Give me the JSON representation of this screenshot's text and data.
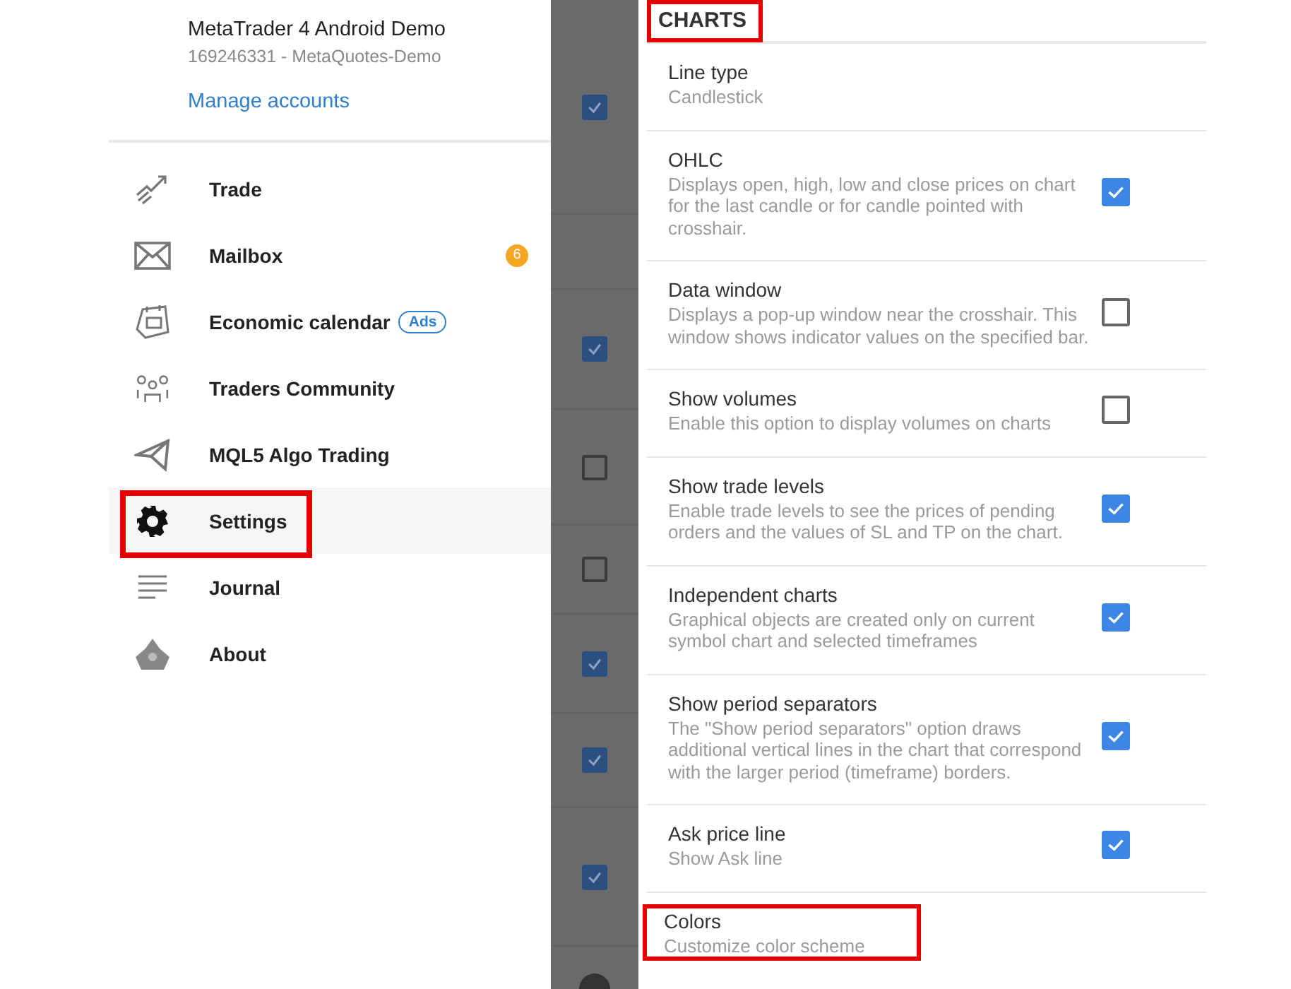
{
  "drawer": {
    "account_name": "MetaTrader 4 Android Demo",
    "account_id": "169246331 - MetaQuotes-Demo",
    "manage_link": "Manage accounts",
    "items": [
      {
        "kind": "trade",
        "label": "Trade",
        "selected": false,
        "outlined": false
      },
      {
        "kind": "mail",
        "label": "Mailbox",
        "badge": "6",
        "selected": false,
        "outlined": false
      },
      {
        "kind": "calendar",
        "label": "Economic calendar",
        "tag": "Ads",
        "selected": false,
        "outlined": false
      },
      {
        "kind": "community",
        "label": "Traders Community",
        "selected": false,
        "outlined": false
      },
      {
        "kind": "send",
        "label": "MQL5 Algo Trading",
        "selected": false,
        "outlined": false
      },
      {
        "kind": "settings",
        "label": "Settings",
        "selected": true,
        "outlined": true
      },
      {
        "kind": "journal",
        "label": "Journal",
        "selected": false,
        "outlined": false
      },
      {
        "kind": "about",
        "label": "About",
        "selected": false,
        "outlined": false
      }
    ]
  },
  "background_rows": [
    {
      "kind": "checkbox",
      "checked": true
    },
    {
      "kind": "blank"
    },
    {
      "kind": "checkbox",
      "checked": true
    },
    {
      "kind": "checkbox",
      "checked": false
    },
    {
      "kind": "checkbox",
      "checked": false
    },
    {
      "kind": "checkbox",
      "checked": true
    },
    {
      "kind": "checkbox",
      "checked": true
    },
    {
      "kind": "checkbox",
      "checked": true
    },
    {
      "kind": "circle"
    }
  ],
  "settings": {
    "section": "CHARTS",
    "section_outlined": true,
    "items": [
      {
        "kind": "value",
        "title": "Line type",
        "description": "Candlestick",
        "outlined": false
      },
      {
        "kind": "checkbox",
        "title": "OHLC",
        "description": "Displays open, high, low and close prices on chart for the last candle or for candle pointed with crosshair.",
        "checked": true,
        "outlined": false
      },
      {
        "kind": "checkbox",
        "title": "Data window",
        "description": "Displays a pop-up window near the crosshair. This window shows indicator values on the specified bar.",
        "checked": false,
        "outlined": false
      },
      {
        "kind": "checkbox",
        "title": "Show volumes",
        "description": "Enable this option to display volumes on charts",
        "checked": false,
        "outlined": false
      },
      {
        "kind": "checkbox",
        "title": "Show trade levels",
        "description": "Enable trade levels to see the prices of pending orders and the values of SL and TP on the chart.",
        "checked": true,
        "outlined": false
      },
      {
        "kind": "checkbox",
        "title": "Independent charts",
        "description": "Graphical objects are created only on current symbol chart and selected timeframes",
        "checked": true,
        "outlined": false
      },
      {
        "kind": "checkbox",
        "title": "Show period separators",
        "description": "The \"Show period separators\" option draws additional vertical lines in the chart that correspond with the larger period (timeframe) borders.",
        "checked": true,
        "outlined": false
      },
      {
        "kind": "checkbox",
        "title": "Ask price line",
        "description": "Show Ask line",
        "checked": true,
        "outlined": false
      },
      {
        "kind": "value",
        "title": "Colors",
        "description": "Customize color scheme",
        "outlined": true
      }
    ]
  }
}
